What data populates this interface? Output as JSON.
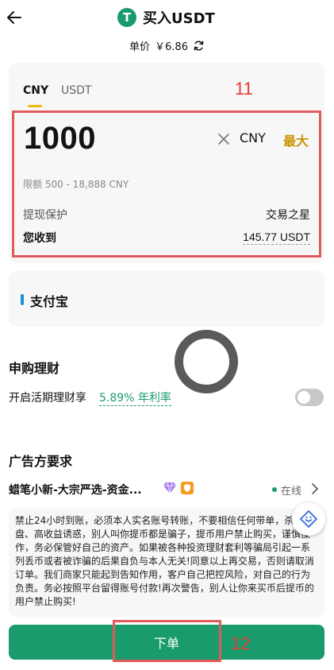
{
  "header": {
    "title": "买入USDT",
    "coin_icon": "T",
    "price_label": "单价",
    "price_value": "￥6.86"
  },
  "tabs": [
    {
      "label": "CNY",
      "active": true
    },
    {
      "label": "USDT",
      "active": false
    }
  ],
  "annotations": {
    "box_1": "11",
    "box_2": "12"
  },
  "amount_input": {
    "value": "1000",
    "currency": "CNY",
    "max_label": "最大",
    "limit_text": "限额 500 - 18,888 CNY"
  },
  "withdraw_protection": {
    "label": "提现保护",
    "value": "交易之星"
  },
  "receive": {
    "label": "您收到",
    "value": "145.77 USDT"
  },
  "payment": {
    "method": "支付宝",
    "accent": "#1d8fd8"
  },
  "finance": {
    "title": "申购理财",
    "toggle_label": "开启活期理财享",
    "rate_text": "5.89% 年利率",
    "toggle_on": false
  },
  "advertiser": {
    "section_title": "广告方要求",
    "merchant_name": "蜡笔小新-大宗严选-资金...",
    "status": "在线",
    "terms": "禁止24小时到账，必须本人实名账号转账，不要相信任何带单，杀盘金盘、高收益诱惑，别人叫你提币都是骗子，提币用户禁止购买，谨慎操作，务必保管好自己的资产。如果被各种投资理财套利等骗局引起一系列丢币或者被诈骗的后果自负与本人无关!同意以上再交易，否则请取消订单。我们商家只能起到告知作用，客户自己把控风险，对自己的行为负责。务必按照平台留得账号付款!再次警告，别人让你来买币后提币的用户禁止购买!"
  },
  "order_button": {
    "label": "下单"
  },
  "colors": {
    "brand_green": "#1a9b6c",
    "max_gold": "#c99400",
    "annotation_red": "#e05b5b"
  }
}
